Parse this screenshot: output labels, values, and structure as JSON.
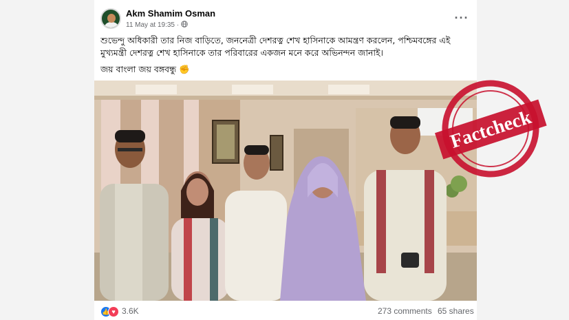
{
  "post": {
    "author": "Akm Shamim Osman",
    "timestamp": "11 May at 19:35 · ",
    "more_icon": "ellipsis-icon",
    "text_line1": "শুভেন্দু অধিকারী তার নিজ বাড়িতে, জননেত্রী দেশরত্ন শেখ হাসিনাকে আমন্ত্রণ করলেন, পশ্চিমবঙ্গের এই মুখ্যমন্ত্রী দেশরত্ন শেখ হাসিনাকে তার পরিবারের একজন মনে করে অভিনন্দন জানাই।",
    "text_line2": "জয় বাংলা জয় বঙ্গবন্ধু ✊",
    "privacy_icon": "globe-icon"
  },
  "stats": {
    "reactions": "3.6K",
    "comments": "273 comments",
    "shares": "65 shares"
  },
  "stamp": {
    "text": "Factcheck",
    "color": "#c8102e"
  }
}
